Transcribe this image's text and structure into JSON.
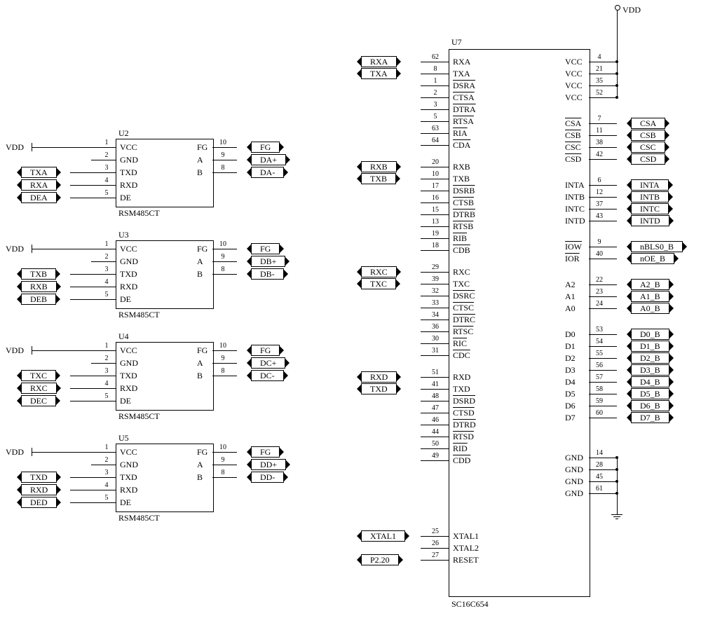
{
  "vdd_label": "VDD",
  "transceivers": [
    {
      "ref": "U2",
      "part": "RSM485CT",
      "left_nets": [
        "VDD",
        "",
        "TXA",
        "RXA",
        "DEA"
      ],
      "right_nets": [
        "FG",
        "DA+",
        "DA-"
      ]
    },
    {
      "ref": "U3",
      "part": "RSM485CT",
      "left_nets": [
        "VDD",
        "",
        "TXB",
        "RXB",
        "DEB"
      ],
      "right_nets": [
        "FG",
        "DB+",
        "DB-"
      ]
    },
    {
      "ref": "U4",
      "part": "RSM485CT",
      "left_nets": [
        "VDD",
        "",
        "TXC",
        "RXC",
        "DEC"
      ],
      "right_nets": [
        "FG",
        "DC+",
        "DC-"
      ]
    },
    {
      "ref": "U5",
      "part": "RSM485CT",
      "left_nets": [
        "VDD",
        "",
        "TXD",
        "RXD",
        "DED"
      ],
      "right_nets": [
        "FG",
        "DD+",
        "DD-"
      ]
    }
  ],
  "trx_left_pins": [
    {
      "l": "VCC",
      "n": "1"
    },
    {
      "l": "GND",
      "n": "2"
    },
    {
      "l": "TXD",
      "n": "3"
    },
    {
      "l": "RXD",
      "n": "4"
    },
    {
      "l": "DE",
      "n": "5"
    }
  ],
  "trx_right_pins": [
    {
      "l": "FG",
      "n": "10"
    },
    {
      "l": "A",
      "n": "9"
    },
    {
      "l": "B",
      "n": "8"
    }
  ],
  "uart": {
    "ref": "U7",
    "part": "SC16C654",
    "groups_left": [
      {
        "ext": [
          "RXA",
          "TXA"
        ],
        "pins": [
          {
            "l": "RXA",
            "n": "62"
          },
          {
            "l": "TXA",
            "n": "8"
          },
          {
            "l": "DSRA",
            "n": "1",
            "ov": 1
          },
          {
            "l": "CTSA",
            "n": "2",
            "ov": 1
          },
          {
            "l": "DTRA",
            "n": "3",
            "ov": 1
          },
          {
            "l": "RTSA",
            "n": "5",
            "ov": 1
          },
          {
            "l": "RIA",
            "n": "63",
            "ov": 1
          },
          {
            "l": "CDA",
            "n": "64",
            "ov": 1
          }
        ]
      },
      {
        "ext": [
          "RXB",
          "TXB"
        ],
        "pins": [
          {
            "l": "RXB",
            "n": "20"
          },
          {
            "l": "TXB",
            "n": "10"
          },
          {
            "l": "DSRB",
            "n": "17",
            "ov": 1
          },
          {
            "l": "CTSB",
            "n": "16",
            "ov": 1
          },
          {
            "l": "DTRB",
            "n": "15",
            "ov": 1
          },
          {
            "l": "RTSB",
            "n": "13",
            "ov": 1
          },
          {
            "l": "RIB",
            "n": "19",
            "ov": 1
          },
          {
            "l": "CDB",
            "n": "18",
            "ov": 1
          }
        ]
      },
      {
        "ext": [
          "RXC",
          "TXC"
        ],
        "pins": [
          {
            "l": "RXC",
            "n": "29"
          },
          {
            "l": "TXC",
            "n": "39"
          },
          {
            "l": "DSRC",
            "n": "32",
            "ov": 1
          },
          {
            "l": "CTSC",
            "n": "33",
            "ov": 1
          },
          {
            "l": "DTRC",
            "n": "34",
            "ov": 1
          },
          {
            "l": "RTSC",
            "n": "36",
            "ov": 1
          },
          {
            "l": "RIC",
            "n": "30",
            "ov": 1
          },
          {
            "l": "CDC",
            "n": "31",
            "ov": 1
          }
        ]
      },
      {
        "ext": [
          "RXD",
          "TXD"
        ],
        "pins": [
          {
            "l": "RXD",
            "n": "51"
          },
          {
            "l": "TXD",
            "n": "41"
          },
          {
            "l": "DSRD",
            "n": "48",
            "ov": 1
          },
          {
            "l": "CTSD",
            "n": "47",
            "ov": 1
          },
          {
            "l": "DTRD",
            "n": "46",
            "ov": 1
          },
          {
            "l": "RTSD",
            "n": "44",
            "ov": 1
          },
          {
            "l": "RID",
            "n": "50",
            "ov": 1
          },
          {
            "l": "CDD",
            "n": "49",
            "ov": 1
          }
        ]
      }
    ],
    "xtal": [
      {
        "l": "XTAL1",
        "n": "25",
        "ext": "XTAL1"
      },
      {
        "l": "XTAL2",
        "n": "26",
        "ext": ""
      },
      {
        "l": "RESET",
        "n": "27",
        "ext": "P2.20"
      }
    ],
    "vcc": [
      {
        "n": "4"
      },
      {
        "n": "21"
      },
      {
        "n": "35"
      },
      {
        "n": "52"
      }
    ],
    "cs": [
      {
        "l": "CSA",
        "n": "7",
        "ext": "CSA",
        "ov": 1
      },
      {
        "l": "CSB",
        "n": "11",
        "ext": "CSB",
        "ov": 1
      },
      {
        "l": "CSC",
        "n": "38",
        "ext": "CSC",
        "ov": 1
      },
      {
        "l": "CSD",
        "n": "42",
        "ext": "CSD",
        "ov": 1
      }
    ],
    "ints": [
      {
        "l": "INTA",
        "n": "6",
        "ext": "INTA"
      },
      {
        "l": "INTB",
        "n": "12",
        "ext": "INTB"
      },
      {
        "l": "INTC",
        "n": "37",
        "ext": "INTC"
      },
      {
        "l": "INTD",
        "n": "43",
        "ext": "INTD"
      }
    ],
    "io": [
      {
        "l": "IOW",
        "n": "9",
        "ext": "nBLS0_B",
        "ov": 1
      },
      {
        "l": "IOR",
        "n": "40",
        "ext": "nOE_B",
        "ov": 1
      }
    ],
    "addr": [
      {
        "l": "A2",
        "n": "22",
        "ext": "A2_B"
      },
      {
        "l": "A1",
        "n": "23",
        "ext": "A1_B"
      },
      {
        "l": "A0",
        "n": "24",
        "ext": "A0_B"
      }
    ],
    "data": [
      {
        "l": "D0",
        "n": "53",
        "ext": "D0_B"
      },
      {
        "l": "D1",
        "n": "54",
        "ext": "D1_B"
      },
      {
        "l": "D2",
        "n": "55",
        "ext": "D2_B"
      },
      {
        "l": "D3",
        "n": "56",
        "ext": "D3_B"
      },
      {
        "l": "D4",
        "n": "57",
        "ext": "D4_B"
      },
      {
        "l": "D5",
        "n": "58",
        "ext": "D5_B"
      },
      {
        "l": "D6",
        "n": "59",
        "ext": "D6_B"
      },
      {
        "l": "D7",
        "n": "60",
        "ext": "D7_B"
      }
    ],
    "gnd": [
      {
        "n": "14"
      },
      {
        "n": "28"
      },
      {
        "n": "45"
      },
      {
        "n": "61"
      }
    ]
  }
}
